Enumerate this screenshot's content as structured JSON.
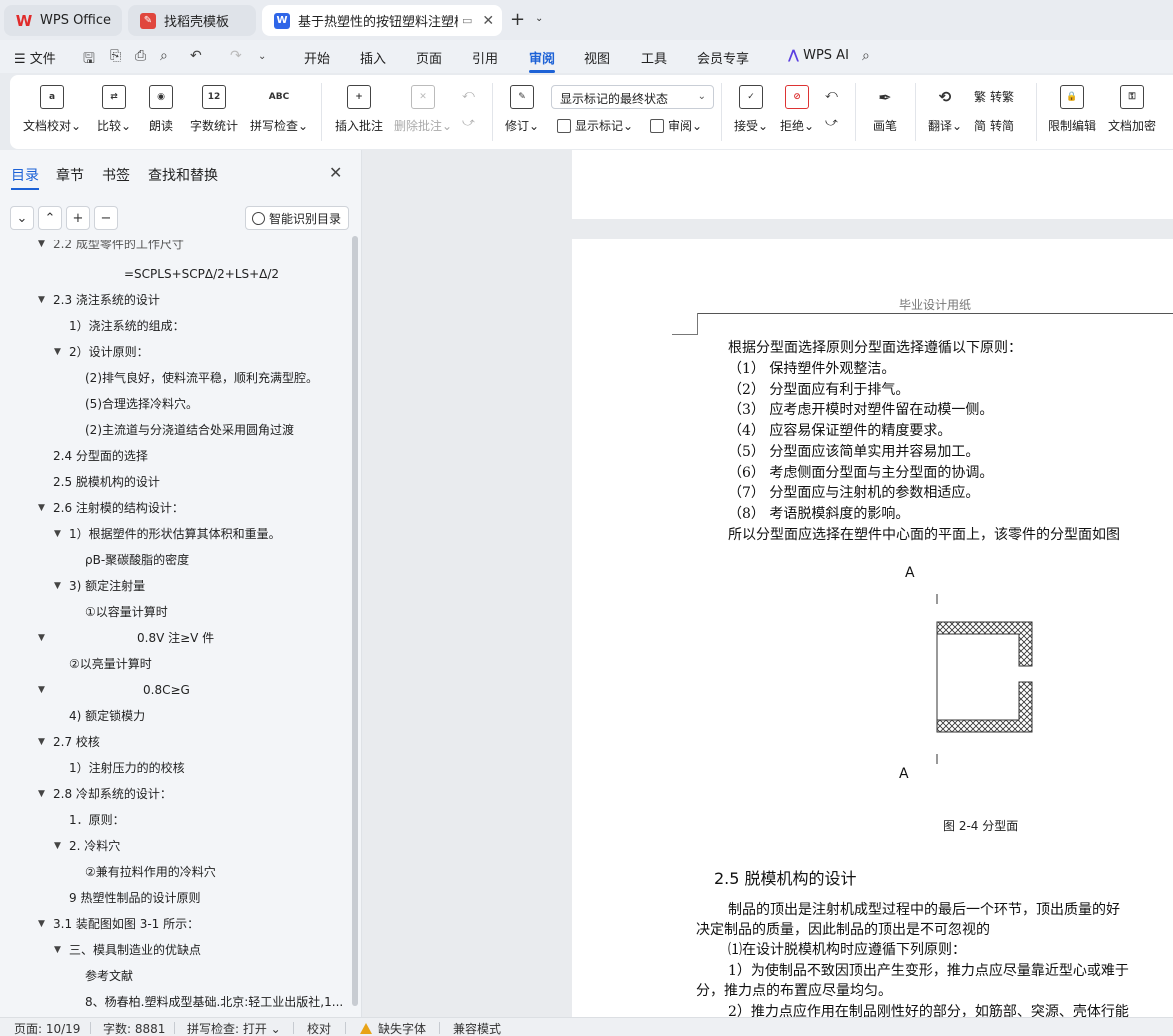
{
  "tabs": [
    {
      "label": "WPS Office"
    },
    {
      "label": "找稻壳模板"
    },
    {
      "label": "基于热塑性的按钮塑料注塑模具"
    }
  ],
  "menu": {
    "file": "文件",
    "items": [
      "开始",
      "插入",
      "页面",
      "引用",
      "审阅",
      "视图",
      "工具",
      "会员专享"
    ],
    "active": "审阅",
    "wps_ai": "WPS AI"
  },
  "ribbon": {
    "doc_check": "文档校对",
    "compare": "比较",
    "read_aloud": "朗读",
    "word_count": "字数统计",
    "spell_check": "拼写检查",
    "insert_comment": "插入批注",
    "delete_comment": "删除批注",
    "revise": "修订",
    "markup_state": "显示标记的最终状态",
    "show_markup": "显示标记",
    "review": "审阅",
    "accept": "接受",
    "reject": "拒绝",
    "pen": "画笔",
    "translate": "翻译",
    "to_traditional": "转繁",
    "to_simplified": "转简",
    "restrict_edit": "限制编辑",
    "doc_encrypt": "文档加密",
    "word_count_icon_text": "12",
    "spell_icon_text": "ABC"
  },
  "panel": {
    "tabs": [
      "目录",
      "章节",
      "书签",
      "查找和替换"
    ],
    "smart_toc": "智能识别目录",
    "toc": [
      "2.2 成型零件的工作尺寸",
      "=SCPLS+SCPΔ/2+LS+Δ/2",
      "2.3  浇注系统的设计",
      "1）浇注系统的组成：",
      "2）设计原则：",
      "(2)排气良好，使料流平稳，顺利充满型腔。",
      "(5)合理选择冷料穴。",
      "(2)主流道与分浇道结合处采用圆角过渡",
      "2.4  分型面的选择",
      "2.5  脱模机构的设计",
      "2.6  注射模的结构设计：",
      "1）根据塑件的形状估算其体积和重量。",
      "ρB-聚碳酸脂的密度",
      "3)      额定注射量",
      "①以容量计算时",
      "0.8V 注≥V 件",
      "②以亮量计算时",
      "0.8C≥G",
      "4)      额定锁模力",
      "2.7 校核",
      "1）注射压力的的校核",
      "2.8  冷却系统的设计：",
      "1．原则：",
      "2.  冷料穴",
      "②兼有拉料作用的冷料穴",
      "9 热塑性制品的设计原则",
      "3.1 装配图如图 3-1 所示：",
      "三、模具制造业的优缺点",
      "参考文献",
      "8、杨春柏.塑料成型基础.北京:轻工业出版社,1..."
    ]
  },
  "document": {
    "header": "毕业设计用纸",
    "lines": [
      "根据分型面选择原则分型面选择遵循以下原则：",
      "（1）   保持塑件外观整洁。",
      "（2）   分型面应有利于排气。",
      "（3）   应考虑开模时对塑件留在动模一侧。",
      "（4）   应容易保证塑件的精度要求。",
      "（5）   分型面应该简单实用并容易加工。",
      "（6）   考虑侧面分型面与主分型面的协调。",
      "（7）   分型面应与注射机的参数相适应。",
      "（8）   考语脱模斜度的影响。",
      "所以分型面应选择在塑件中心面的平面上，该零件的分型面如图"
    ],
    "fig_label_top": "A",
    "fig_label_bottom": "A",
    "caption": "图 2-4 分型面",
    "heading": "2.5  脱模机构的设计",
    "para": [
      "制品的顶出是注射机成型过程中的最后一个环节，顶出质量的好",
      "决定制品的质量，因此制品的顶出是不可忽视的",
      "⑴在设计脱模机构时应遵循下列原则：",
      "1）为使制品不致因顶出产生变形，推力点应尽量靠近型心或难于",
      "分，推力点的布置应尽量均匀。",
      "2）推力点应作用在制品刚性好的部分，如筋部、突源、壳体行能"
    ]
  },
  "status": {
    "page": "页面: 10/19",
    "words": "字数: 8881",
    "spell": "拼写检查: 打开",
    "proof": "校对",
    "missing_font": "缺失字体",
    "compat": "兼容模式"
  }
}
